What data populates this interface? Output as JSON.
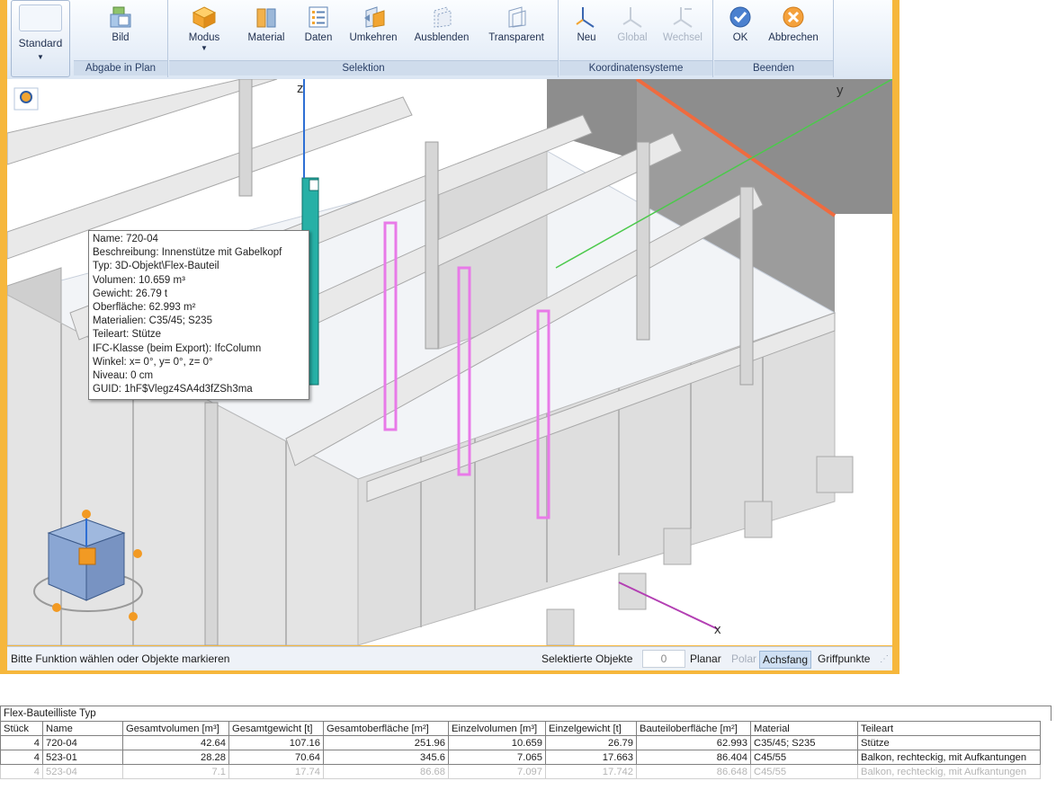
{
  "ribbon": {
    "standard_label": "Standard",
    "groups": [
      {
        "label": "Abgabe in Plan",
        "buttons": [
          {
            "label": "Bild",
            "icon": "image-icon"
          }
        ]
      },
      {
        "label": "Selektion",
        "buttons": [
          {
            "label": "Modus",
            "icon": "cube-mode-icon"
          },
          {
            "label": "Material",
            "icon": "material-icon"
          },
          {
            "label": "Daten",
            "icon": "data-list-icon"
          },
          {
            "label": "Umkehren",
            "icon": "invert-icon"
          },
          {
            "label": "Ausblenden",
            "icon": "hide-icon"
          },
          {
            "label": "Transparent",
            "icon": "transparent-icon"
          }
        ]
      },
      {
        "label": "Koordinatensysteme",
        "buttons": [
          {
            "label": "Neu",
            "icon": "new-axis-icon"
          },
          {
            "label": "Global",
            "icon": "global-axis-icon",
            "disabled": true
          },
          {
            "label": "Wechsel",
            "icon": "switch-axis-icon",
            "disabled": true
          }
        ]
      },
      {
        "label": "Beenden",
        "buttons": [
          {
            "label": "OK",
            "icon": "ok-check-icon"
          },
          {
            "label": "Abbrechen",
            "icon": "cancel-x-icon"
          }
        ]
      }
    ]
  },
  "viewport": {
    "axis_z": "z",
    "axis_y": "y",
    "axis_x": "x",
    "tooltip": [
      "Name: 720-04",
      "Beschreibung: Innenstütze mit Gabelkopf",
      "Typ: 3D-Objekt\\Flex-Bauteil",
      "Volumen: 10.659 m³",
      "Gewicht: 26.79 t",
      "Oberfläche: 62.993 m²",
      "Materialien: C35/45; S235",
      "Teileart: Stütze",
      "IFC-Klasse (beim Export): IfcColumn",
      "Winkel: x= 0°, y= 0°, z= 0°",
      "Niveau: 0 cm",
      "GUID: 1hF$Vlegz4SA4d3fZSh3ma"
    ]
  },
  "status": {
    "prompt": "Bitte Funktion wählen oder Objekte markieren",
    "selected_label": "Selektierte Objekte",
    "selected_count": "0",
    "toggles": [
      {
        "label": "Planar",
        "state": "normal"
      },
      {
        "label": "Polar",
        "state": "disabled"
      },
      {
        "label": "Achsfang",
        "state": "active"
      },
      {
        "label": "Griffpunkte",
        "state": "normal"
      }
    ]
  },
  "table": {
    "title": "Flex-Bauteilliste Typ",
    "columns": [
      "Stück",
      "Name",
      "Gesamtvolumen [m³]",
      "Gesamtgewicht [t]",
      "Gesamtoberfläche [m²]",
      "Einzelvolumen [m³]",
      "Einzelgewicht [t]",
      "Bauteiloberfläche [m²]",
      "Material",
      "Teileart"
    ],
    "rows": [
      [
        "4",
        "720-04",
        "42.64",
        "107.16",
        "251.96",
        "10.659",
        "26.79",
        "62.993",
        "C35/45; S235",
        "Stütze"
      ],
      [
        "4",
        "523-01",
        "28.28",
        "70.64",
        "345.6",
        "7.065",
        "17.663",
        "86.404",
        "C45/55",
        "Balkon, rechteckig, mit Aufkantungen"
      ],
      [
        "4",
        "523-04",
        "7.1",
        "17.74",
        "86.68",
        "7.097",
        "17.742",
        "86.648",
        "C45/55",
        "Balkon, rechteckig, mit Aufkantungen"
      ]
    ]
  },
  "colors": {
    "frame": "#f6b73c",
    "selection": "#e87ae8",
    "highlight": "#27b0a6",
    "accent_red": "#ef6b3f",
    "axis_green": "#4cc94c",
    "axis_blue": "#2e6fd4"
  }
}
